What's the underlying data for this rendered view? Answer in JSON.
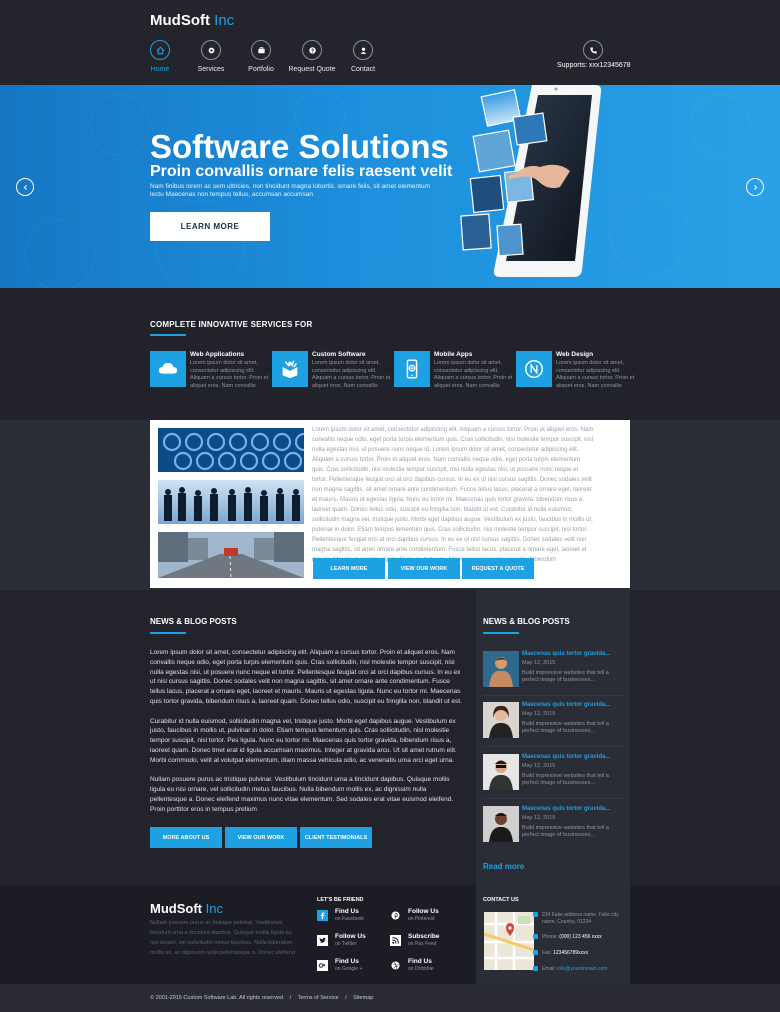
{
  "header": {
    "logo_main": "MudSoft",
    "logo_accent": "Inc",
    "nav": [
      {
        "label": "Home",
        "icon": "home-icon",
        "active": true
      },
      {
        "label": "Services",
        "icon": "services-icon",
        "active": false
      },
      {
        "label": "Portfolio",
        "icon": "portfolio-icon",
        "active": false
      },
      {
        "label": "Request Quote",
        "icon": "request-quote-icon",
        "active": false
      },
      {
        "label": "Contact",
        "icon": "contact-icon",
        "active": false
      }
    ],
    "support_label": "Supports: xxx12345678",
    "support_icon": "phone-icon"
  },
  "hero": {
    "title": "Software Solutions",
    "subtitle": "Proin convallis ornare felis raesent velit",
    "description": "Nam finibus lorem ac sem ultricies, non tincidunt magna lobortis.  ornare felis, sit amet elementum lectu Maecenas non tempus tellus, accumsan accumsan",
    "button_label": "LEARN MORE",
    "prev_icon": "chevron-left-icon",
    "next_icon": "chevron-right-icon"
  },
  "services": {
    "heading": "COMPLETE INNOVATIVE SERVICES FOR",
    "items": [
      {
        "title": "Web Applications",
        "text": "Lorem ipsum dolor sit amet, consectetur adipiscing elit. Aliquam a cursus tortor. Proin et aliquet eros. Nam convallis",
        "icon": "cloud-icon"
      },
      {
        "title": "Custom Software",
        "text": "Lorem ipsum dolor sit amet, consectetur adipiscing elit. Aliquam a cursus tortor. Proin et aliquet eros. Nam convallis",
        "icon": "software-box-icon"
      },
      {
        "title": "Mobile Apps",
        "text": "Lorem ipsum dolor sit amet, consectetur adipiscing elit. Aliquam a cursus tortor. Proin et aliquet eros. Nam convallis",
        "icon": "mobile-apps-icon"
      },
      {
        "title": "Web Design",
        "text": "Lorem ipsum dolor sit amet, consectetur adipiscing elit. Aliquam a cursus tortor. Proin et aliquet eros. Nam convallis",
        "icon": "web-design-icon"
      }
    ]
  },
  "about": {
    "text": "Lorem ipsum dolor sit amet, consectetur adipiscing elit. Aliquam a cursus tortor. Proin et aliquet eros. Nam convallis neque odio, eget porta turpis elementum quis. Cras sollicitudin, nisl molestie tempor suscipit, nisl nulla egestas nisi, ut posuere nunc neque id. Lorem ipsum dolor sit amet, consectetur adipiscing elit. Aliquam a cursus tortor. Proin et aliquet eros. Nam convallis neque odio, eget porta turpis elementum quis. Cras sollicitudin, nisl molestie tempor suscipit, nisl nulla egestas nisi, ut posuere nunc neque et tortor. Pellentesque feugiat orci at orci dapibus cursus. In eu ex ut nisl cursus sagittis. Donec sodales velit non magna sagittis, sit amet ornare ante condimentum. Fusce tellus lacus, placerat a ornare eget, laoreet et mauris. Mauris ut egestas ligula. Nunc eu tortor mi. Maecenas quis tortor gravida, bibendum risus a, laoreet quam. Donec tellus odio, suscipit eu fringilla non, blandit ut est. Curabitur id nulla euismod, sollicitudin magna vel, tristique justo. Morbi eget dapibus augue. Vestibulum ex justo, faucibus in mollis ut, pulvinar in dolor. Etiam tempus lementum quis. Cras sollicitudin, nisl molestie tempor suscipit, nisl tortor. Pellentesque feugiat orci at orci dapibus cursus. In eu ex ut nisl cursus sagittis. Donec sodales velit non magna sagittis, sit amet ornare ante condimentum. Fusce tellus lacus, placerat a ornare eget, laoreet et mauris. Mauris ut egestas ligula. Nunc eu tortor mi. Maecenas quis tortor gravida, bibendum",
    "buttons": [
      "LEARN MORE",
      "VIEW OUR WORK",
      "REQUEST A QUOTE"
    ]
  },
  "news": {
    "heading": "NEWS & BLOG POSTS",
    "paragraphs": [
      "Lorem ipsum dolor sit amet, consectetur adipiscing elit. Aliquam a cursus tortor. Proin et aliquet eros. Nam convallis neque odio, eget porta turpis elementum quis. Cras sollicitudin, nisl molestie tempor suscipit, nisl nulla egestas nisi, ut posuere nunc neque et tortor. Pellentesque feugiat orci at orci dapibus cursus. In eu ex ut nisl cursus sagittis. Donec sodales velit non magna sagittis, sit amet ornare ante condimentum. Fusce tellus lacus, placerat a ornare eget, laoreet et mauris. Mauris ut egestas ligula. Nunc eu tortor mi. Maecenas quis tortor gravida, bibendum risus a, laoreet quam. Donec tellus odio, suscipit eu fringilla non, blandit ut est.",
      "Curabitur id nulla euismod, sollicitudin magna vel, tristique justo. Morbi eget dapibus augue. Vestibulum ex justo, faucibus in mollis ut, pulvinar in dolor. Etiam tempus lementum quis. Cras sollicitudin, nisl molestie tempor suscipit, nisl tortor. Pes ligula. Nunc eu tortor mi. Maecenas quis tortor gravida, bibendum risus a, laoreet quam. Donec tmet erat id ligula accumsan maximus. Integer at gravida arcu. Ut sit amet rutrum elit. Morbi commodo, velit at volutpat elementum, diam massa vehicula odio, ac venenatis urna orci eget urna.",
      "Nullam posuere purus ac tristique pulvinar. Vestibulum tincidunt urna a tincidunt dapibus. Quisque mollis ligula eu nisi ornare, vel sollicitudin metus faucibus. Nulla bibendum mollis ex, ac dignissim nulla pellentesque a. Donec eleifend maximus nunc vitae elementum. Sed sodales erat vitae euismod eleifend. Proin porttitor eros in tempus pretium"
    ],
    "buttons": [
      "MORE ABOUT US",
      "VIEW OUR WORK",
      "CLIENT TESTIMONIALS"
    ]
  },
  "sidebar": {
    "heading": "NEWS & BLOG POSTS",
    "posts": [
      {
        "title": "Maecenas quis tortor gravida...",
        "date": "May 12, 2015",
        "text": "Build impressive websites that tell a perfect image of businesses..."
      },
      {
        "title": "Maecenas quis tortor gravida...",
        "date": "May 12, 2015",
        "text": "Build impressive websites that tell a perfect image of businesses..."
      },
      {
        "title": "Maecenas quis tortor gravida...",
        "date": "May 12, 2015",
        "text": "Build impressive websites that tell a perfect image of businesses..."
      },
      {
        "title": "Maecenas quis tortor gravida...",
        "date": "May 12, 2015",
        "text": "Build impressive websites that tell a perfect image of businesses..."
      }
    ],
    "read_more": "Read more"
  },
  "footer": {
    "logo_main": "MudSoft",
    "logo_accent": "Inc",
    "text": "Nullam posuere purus ac tristique pulvinar. Vestibulum tincidunt urna a tincidunt dapibus. Quisque mollis ligula eu nisi ornare, vel sollicitudin metus faucibus. Nulla bibendum mollis ex, ac dignissim nulla pellentesque a. Donec eleifend",
    "friend_heading": "LET'S BE FRIEND",
    "social": [
      {
        "title": "Find Us",
        "sub": "on Facebook",
        "icon": "facebook-icon"
      },
      {
        "title": "Follow Us",
        "sub": "on Pinterest",
        "icon": "pinterest-icon"
      },
      {
        "title": "Follow Us",
        "sub": "on Twitter",
        "icon": "twitter-icon"
      },
      {
        "title": "Subscribe",
        "sub": "on Rss Feed",
        "icon": "rss-icon"
      },
      {
        "title": "Find Us",
        "sub": "on Google +",
        "icon": "google-plus-icon"
      },
      {
        "title": "Find Us",
        "sub": "on Dribbble",
        "icon": "dribbble-icon"
      }
    ],
    "contact": {
      "heading": "CONTACT US",
      "address": "234 Fake address name, Fake city name, Country, 01234",
      "phone_label": "Phone:",
      "phone": "(000) 123 456 xxxx",
      "fax_label": "Fax:",
      "fax": "123456789xxxx",
      "email_label": "Email:",
      "email": "info@yourdomain.com"
    },
    "bottom": {
      "copyright": "© 2001-2015 Custom Software Lab. All rights reserved",
      "sep": "/",
      "terms": "Terms of Service",
      "sitemap": "Sitemap"
    }
  }
}
